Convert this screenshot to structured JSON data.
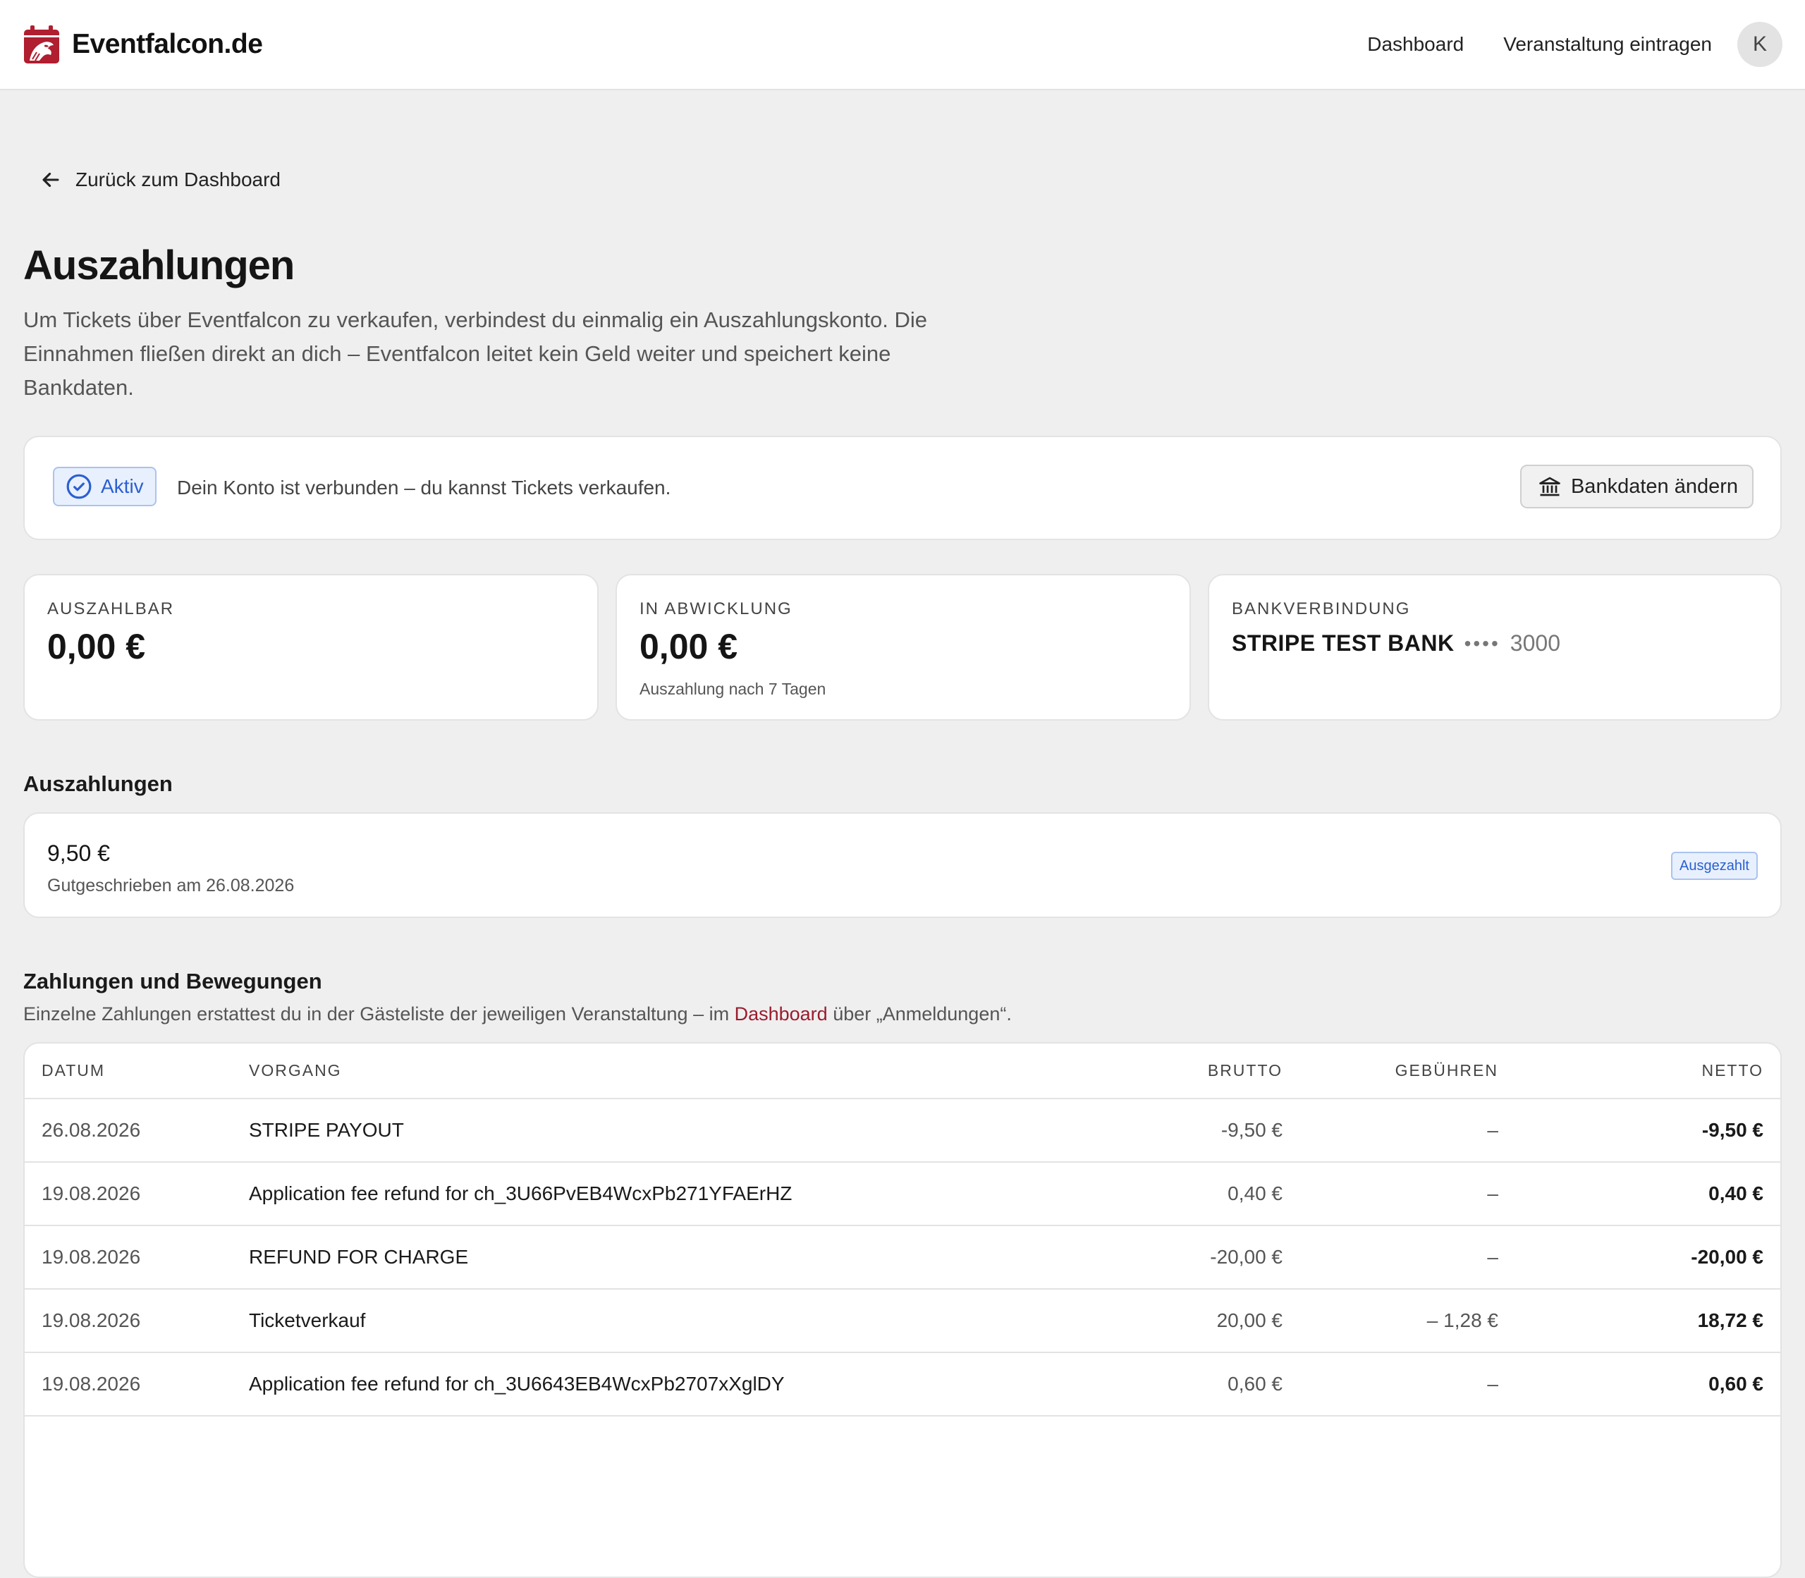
{
  "header": {
    "brand": "Eventfalcon.de",
    "nav": [
      "Dashboard",
      "Veranstaltung eintragen"
    ],
    "avatar_initial": "K",
    "brand_color": "#b01e2f"
  },
  "back_link": "Zurück zum Dashboard",
  "page_title": "Auszahlungen",
  "intro": "Um Tickets über Eventfalcon zu verkaufen, verbindest du einmalig ein Auszahlungskonto. Die Einnahmen fließen direkt an dich – Eventfalcon leitet kein Geld weiter und speichert keine Bankdaten.",
  "status": {
    "badge": "Aktiv",
    "text": "Dein Konto ist verbunden – du kannst Tickets verkaufen.",
    "button": "Bankdaten ändern"
  },
  "stats": {
    "payable": {
      "label": "AUSZAHLBAR",
      "value": "0,00 €"
    },
    "processing": {
      "label": "IN ABWICKLUNG",
      "value": "0,00 €",
      "sub": "Auszahlung nach 7 Tagen"
    },
    "bank": {
      "label": "BANKVERBINDUNG",
      "name": "STRIPE TEST BANK",
      "masked": "••••",
      "last4": "3000"
    }
  },
  "payouts": {
    "title": "Auszahlungen",
    "items": [
      {
        "amount": "9,50 €",
        "sub": "Gutgeschrieben am 26.08.2026",
        "status": "Ausgezahlt"
      }
    ]
  },
  "transactions": {
    "title": "Zahlungen und Bewegungen",
    "desc_before": "Einzelne Zahlungen erstattest du in der Gästeliste der jeweiligen Veranstaltung – im ",
    "desc_link": "Dashboard",
    "desc_after": " über „Anmeldungen“.",
    "columns": [
      "DATUM",
      "VORGANG",
      "BRUTTO",
      "GEBÜHREN",
      "NETTO"
    ],
    "rows": [
      {
        "date": "26.08.2026",
        "desc": "STRIPE PAYOUT",
        "brutto": "-9,50 €",
        "fees": "–",
        "netto": "-9,50 €"
      },
      {
        "date": "19.08.2026",
        "desc": "Application fee refund for ch_3U66PvEB4WcxPb271YFAErHZ",
        "brutto": "0,40 €",
        "fees": "–",
        "netto": "0,40 €"
      },
      {
        "date": "19.08.2026",
        "desc": "REFUND FOR CHARGE",
        "brutto": "-20,00 €",
        "fees": "–",
        "netto": "-20,00 €"
      },
      {
        "date": "19.08.2026",
        "desc": "Ticketverkauf",
        "brutto": "20,00 €",
        "fees": "– 1,28 €",
        "netto": "18,72 €"
      },
      {
        "date": "19.08.2026",
        "desc": "Application fee refund for ch_3U6643EB4WcxPb2707xXglDY",
        "brutto": "0,60 €",
        "fees": "–",
        "netto": "0,60 €"
      }
    ]
  }
}
